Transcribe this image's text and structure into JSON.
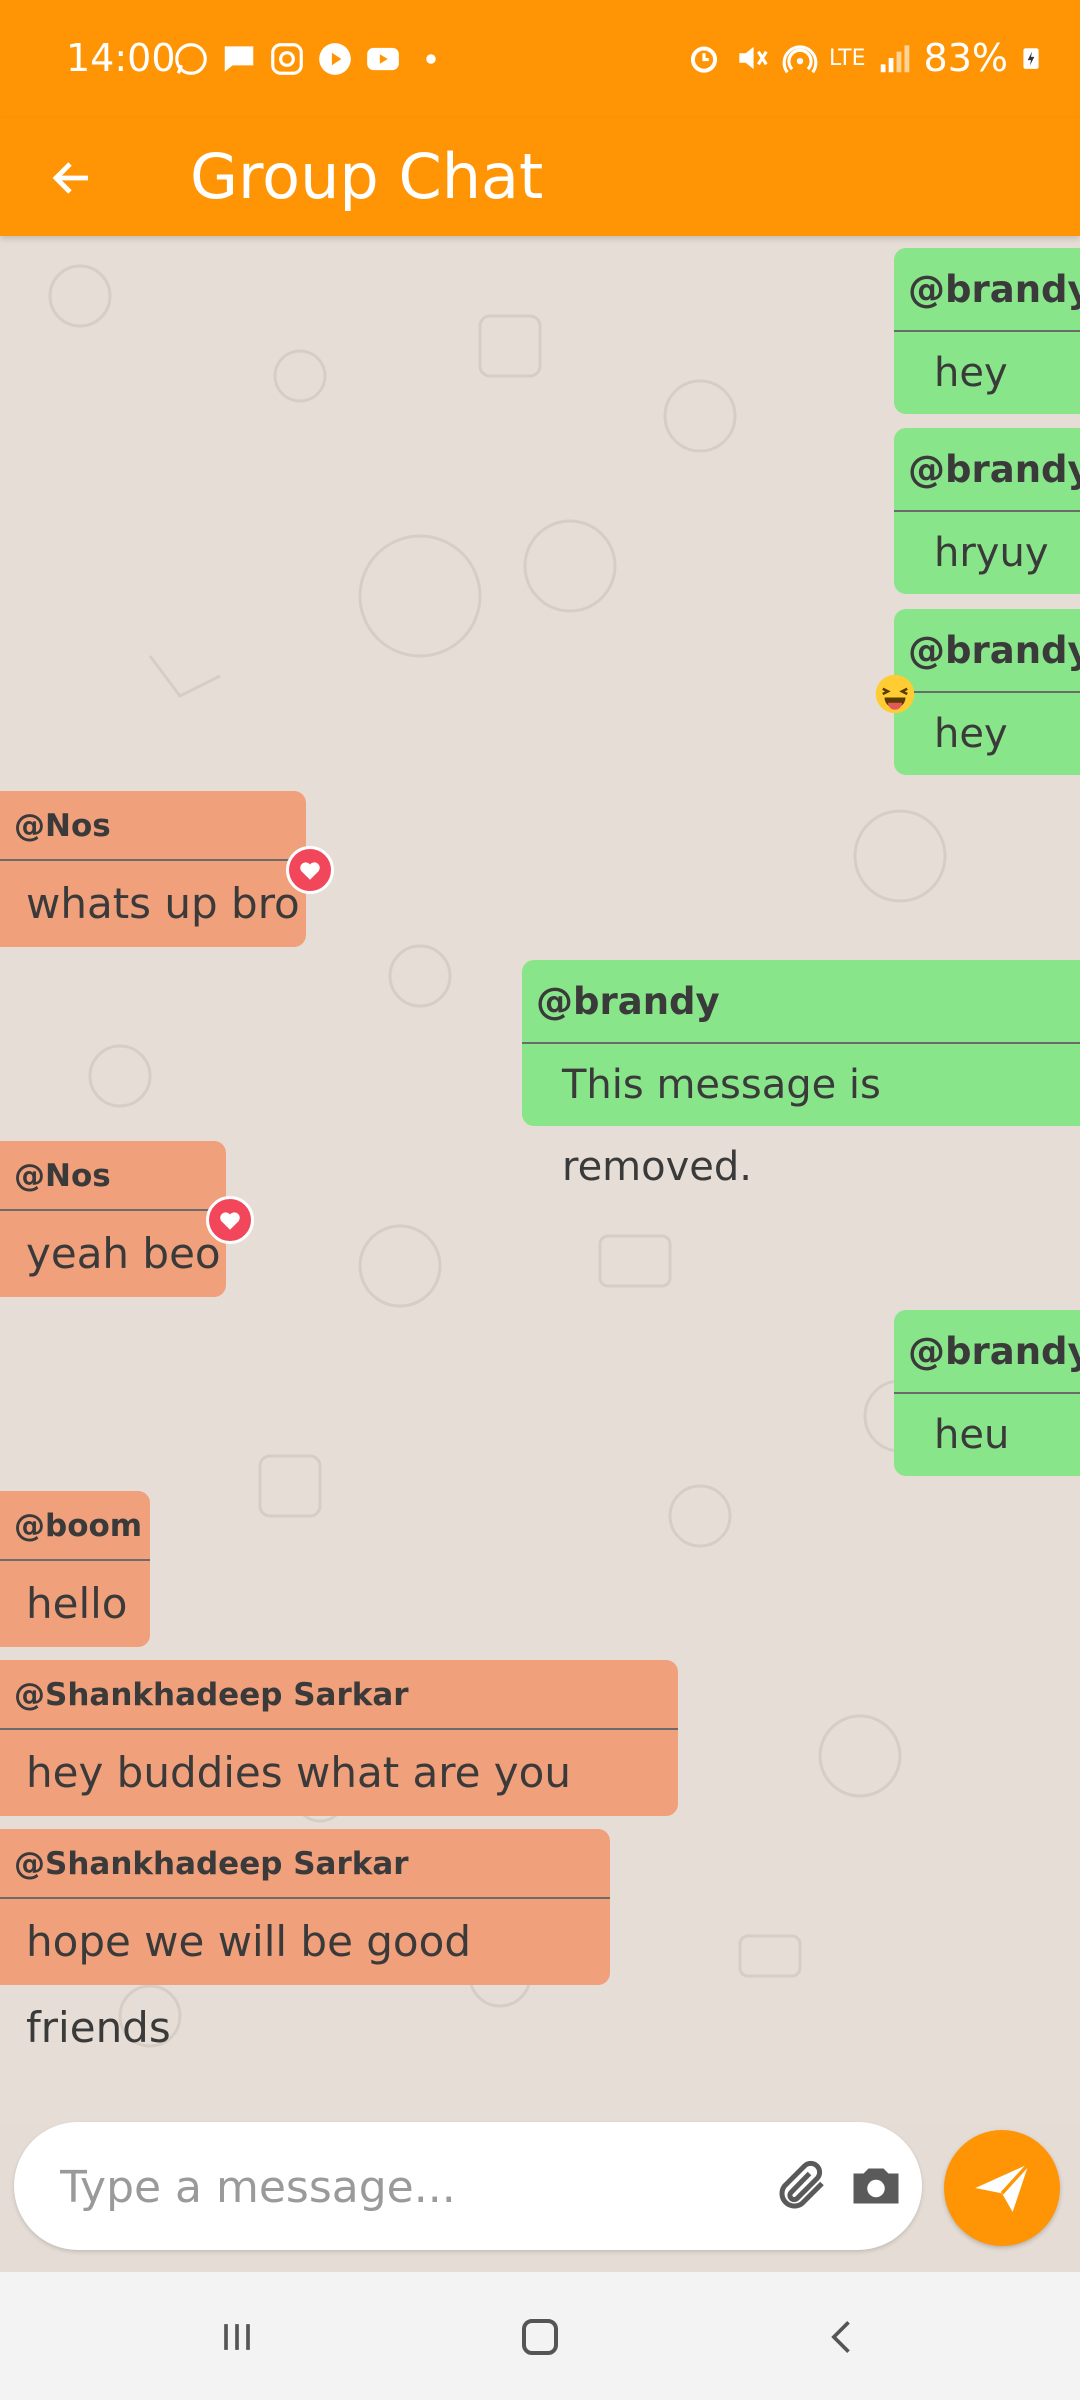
{
  "status_bar": {
    "time": "14:00",
    "battery": "83%",
    "network": "LTE"
  },
  "app_bar": {
    "title": "Group Chat"
  },
  "messages": [
    {
      "side": "right",
      "sender": "@brandy",
      "text": "hey"
    },
    {
      "side": "right",
      "sender": "@brandy",
      "text": "hryuy"
    },
    {
      "side": "right",
      "sender": "@brandy",
      "text": "hey",
      "reaction": "laughing-emoji"
    },
    {
      "side": "left",
      "sender": "@Nos",
      "text": "whats up bro",
      "reaction": "heart"
    },
    {
      "side": "right",
      "sender": "@brandy",
      "text": "This message is removed."
    },
    {
      "side": "left",
      "sender": "@Nos",
      "text": "yeah beo",
      "reaction": "heart"
    },
    {
      "side": "right",
      "sender": "@brandy",
      "text": "heu"
    },
    {
      "side": "left",
      "sender": "@boom",
      "text": "hello"
    },
    {
      "side": "left",
      "sender": "@Shankhadeep Sarkar",
      "text": "hey buddies what are you doing"
    },
    {
      "side": "left",
      "sender": "@Shankhadeep Sarkar",
      "text": "hope we will be good friends"
    }
  ],
  "composer": {
    "placeholder": "Type a message..."
  },
  "colors": {
    "accent": "#ff9505",
    "own_bubble": "#89e589",
    "other_bubble": "#f0a07b",
    "heart": "#f2465b"
  }
}
